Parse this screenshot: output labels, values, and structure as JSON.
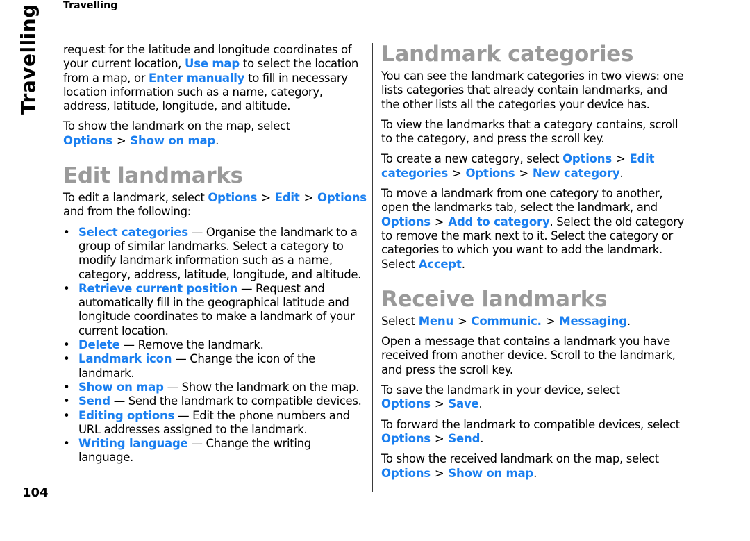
{
  "header": {
    "running_head": "Travelling",
    "side_tab": "Travelling"
  },
  "footer": {
    "page_number": "104"
  },
  "left": {
    "intro": {
      "t1": "request for the latitude and longitude coordinates of your current location, ",
      "l1": "Use map",
      "t2": " to select the location from a map, or ",
      "l2": "Enter manually",
      "t3": " to fill in necessary location information such as a name, category, address, latitude, longitude, and altitude."
    },
    "show_map": {
      "t1": "To show the landmark on the map, select ",
      "l1": "Options",
      "sep": ">",
      "l2": "Show on map",
      "t2": "."
    },
    "edit_heading": "Edit landmarks",
    "edit_intro": {
      "t1": "To edit a landmark, select ",
      "l1": "Options",
      "sep1": ">",
      "l2": "Edit",
      "sep2": ">",
      "l3": "Options",
      "t2": " and from the following:"
    },
    "bullet_glyph": "•",
    "options": [
      {
        "label": "Select categories",
        "desc": " — Organise the landmark to a group of similar landmarks. Select a category to modify landmark information such as a name, category, address, latitude, longitude, and altitude."
      },
      {
        "label": "Retrieve current position",
        "desc": " — Request and automatically fill in the geographical latitude and longitude coordinates to make a landmark of your current location."
      },
      {
        "label": "Delete",
        "desc": " — Remove the landmark."
      },
      {
        "label": "Landmark icon",
        "desc": " — Change the icon of the landmark."
      },
      {
        "label": "Show on map",
        "desc": " — Show the landmark on the map."
      },
      {
        "label": "Send",
        "desc": " — Send the landmark to compatible devices."
      },
      {
        "label": "Editing options",
        "desc": " — Edit the phone numbers and URL addresses assigned to the landmark."
      },
      {
        "label": "Writing language",
        "desc": " — Change the writing language."
      }
    ]
  },
  "right": {
    "cat_heading": "Landmark categories",
    "cat_p1": "You can see the landmark categories in two views: one lists categories that already contain landmarks, and the other lists all the categories your device has.",
    "cat_p2": "To view the landmarks that a category contains, scroll to the category, and press the scroll key.",
    "cat_p3": {
      "t1": "To create a new category, select ",
      "l1": "Options",
      "sep1": ">",
      "l2": "Edit categories",
      "sep2": ">",
      "l3": "Options",
      "sep3": ">",
      "l4": "New category",
      "t2": "."
    },
    "cat_p4": {
      "t1": "To move a landmark from one category to another, open the landmarks tab, select the landmark, and ",
      "l1": "Options",
      "sep1": ">",
      "l2": "Add to category",
      "t2": ". Select the old category to remove the mark next to it. Select the category or categories to which you want to add the landmark. Select ",
      "l3": "Accept",
      "t3": "."
    },
    "recv_heading": "Receive landmarks",
    "recv_p1": {
      "t1": "Select ",
      "l1": "Menu",
      "sep1": ">",
      "l2": "Communic.",
      "sep2": ">",
      "l3": "Messaging",
      "t2": "."
    },
    "recv_p2": "Open a message that contains a landmark you have received from another device. Scroll to the landmark, and press the scroll key.",
    "recv_p3": {
      "t1": "To save the landmark in your device, select ",
      "l1": "Options",
      "sep1": ">",
      "l2": "Save",
      "t2": "."
    },
    "recv_p4": {
      "t1": "To forward the landmark to compatible devices, select ",
      "l1": "Options",
      "sep1": ">",
      "l2": "Send",
      "t2": "."
    },
    "recv_p5": {
      "t1": "To show the received landmark on the map, select ",
      "l1": "Options",
      "sep1": ">",
      "l2": "Show on map",
      "t2": "."
    }
  },
  "colors": {
    "link": "#1a7ff0",
    "heading": "#9a9a9a",
    "text": "#000000",
    "divider": "#3a3a3a"
  }
}
